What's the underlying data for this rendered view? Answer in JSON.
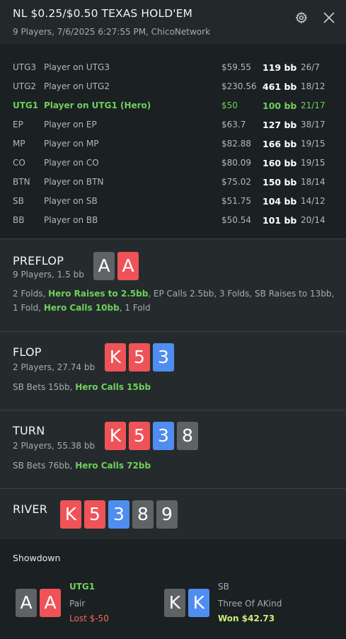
{
  "header": {
    "title": "NL $0.25/$0.50 TEXAS HOLD'EM",
    "subtitle": "9 Players, 7/6/2025 6:27:55 PM, ChicoNetwork"
  },
  "players": [
    {
      "pos": "UTG3",
      "name": "Player on UTG3",
      "stack": "$59.55",
      "bb": "119 bb",
      "vpip": "26/7",
      "hero": false
    },
    {
      "pos": "UTG2",
      "name": "Player on UTG2",
      "stack": "$230.56",
      "bb": "461 bb",
      "vpip": "18/12",
      "hero": false
    },
    {
      "pos": "UTG1",
      "name": "Player on UTG1 (Hero)",
      "stack": "$50",
      "bb": "100 bb",
      "vpip": "21/17",
      "hero": true
    },
    {
      "pos": "EP",
      "name": "Player on EP",
      "stack": "$63.7",
      "bb": "127 bb",
      "vpip": "38/17",
      "hero": false
    },
    {
      "pos": "MP",
      "name": "Player on MP",
      "stack": "$82.88",
      "bb": "166 bb",
      "vpip": "19/15",
      "hero": false
    },
    {
      "pos": "CO",
      "name": "Player on CO",
      "stack": "$80.09",
      "bb": "160 bb",
      "vpip": "19/15",
      "hero": false
    },
    {
      "pos": "BTN",
      "name": "Player on BTN",
      "stack": "$75.02",
      "bb": "150 bb",
      "vpip": "18/14",
      "hero": false
    },
    {
      "pos": "SB",
      "name": "Player on SB",
      "stack": "$51.75",
      "bb": "104 bb",
      "vpip": "14/12",
      "hero": false
    },
    {
      "pos": "BB",
      "name": "Player on BB",
      "stack": "$50.54",
      "bb": "101 bb",
      "vpip": "20/14",
      "hero": false
    }
  ],
  "preflop": {
    "title": "PREFLOP",
    "sub": "9 Players, 1.5 bb",
    "cards": [
      {
        "rank": "A",
        "suit_color": "gray"
      },
      {
        "rank": "A",
        "suit_color": "red"
      }
    ],
    "actions": [
      {
        "text": "2 Folds, ",
        "hero": false
      },
      {
        "text": "Hero Raises to 2.5bb",
        "hero": true
      },
      {
        "text": ", EP Calls 2.5bb, 3 Folds, SB Raises to 13bb, 1 Fold, ",
        "hero": false
      },
      {
        "text": "Hero Calls 10bb",
        "hero": true
      },
      {
        "text": ", 1 Fold",
        "hero": false
      }
    ]
  },
  "flop": {
    "title": "FLOP",
    "sub": "2 Players, 27.74 bb",
    "cards": [
      {
        "rank": "K",
        "suit_color": "red"
      },
      {
        "rank": "5",
        "suit_color": "red"
      },
      {
        "rank": "3",
        "suit_color": "blue"
      }
    ],
    "actions": [
      {
        "text": "SB Bets 15bb, ",
        "hero": false
      },
      {
        "text": "Hero Calls 15bb",
        "hero": true
      }
    ]
  },
  "turn": {
    "title": "TURN",
    "sub": "2 Players, 55.38 bb",
    "cards": [
      {
        "rank": "K",
        "suit_color": "red"
      },
      {
        "rank": "5",
        "suit_color": "red"
      },
      {
        "rank": "3",
        "suit_color": "blue"
      },
      {
        "rank": "8",
        "suit_color": "gray"
      }
    ],
    "actions": [
      {
        "text": "SB Bets 76bb, ",
        "hero": false
      },
      {
        "text": "Hero Calls 72bb",
        "hero": true
      }
    ]
  },
  "river": {
    "title": "RIVER",
    "cards": [
      {
        "rank": "K",
        "suit_color": "red"
      },
      {
        "rank": "5",
        "suit_color": "red"
      },
      {
        "rank": "3",
        "suit_color": "blue"
      },
      {
        "rank": "8",
        "suit_color": "gray"
      },
      {
        "rank": "9",
        "suit_color": "gray"
      }
    ]
  },
  "showdown": {
    "title": "Showdown",
    "hands": [
      {
        "player": "UTG1",
        "hand": "Pair",
        "result": "Lost $-50",
        "cards": [
          {
            "rank": "A",
            "suit_color": "gray"
          },
          {
            "rank": "A",
            "suit_color": "red"
          }
        ],
        "won": false,
        "hero": true
      },
      {
        "player": "SB",
        "hand": "Three Of AKind",
        "result": "Won $42.73",
        "cards": [
          {
            "rank": "K",
            "suit_color": "gray"
          },
          {
            "rank": "K",
            "suit_color": "blue"
          }
        ],
        "won": true,
        "hero": false
      }
    ]
  },
  "colors": {
    "hero_green": "#6fd05b",
    "card_red": "#ef5357",
    "card_blue": "#4f8ef0",
    "card_gray": "#5f6365",
    "lost": "#ef6a5a",
    "won": "#c6f07a"
  },
  "icons": {
    "settings": "gear-icon",
    "close": "close-icon"
  }
}
